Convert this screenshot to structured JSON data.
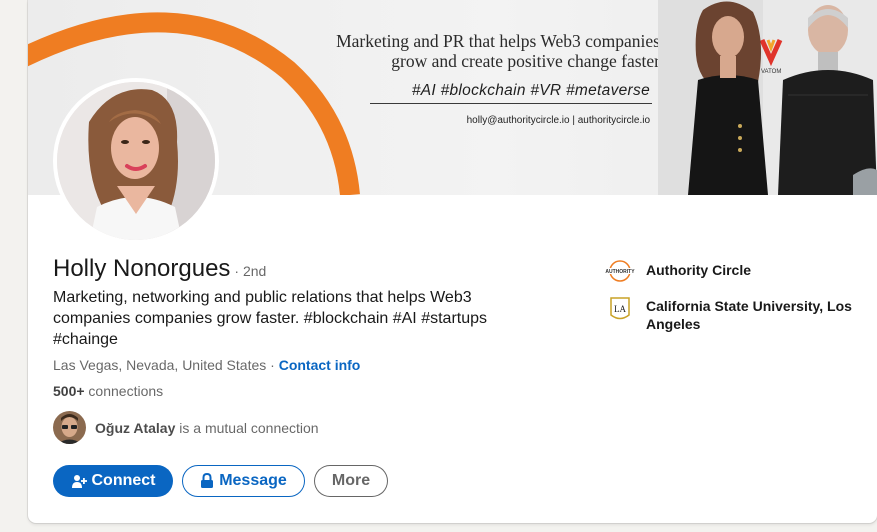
{
  "banner": {
    "headline_line1": "Marketing and PR that helps Web3 companies",
    "headline_line2": "grow and create positive change faster",
    "tags": "#AI #blockchain #VR #metaverse",
    "contact": "holly@authoritycircle.io | authoritycircle.io",
    "vatom_label": "VATOM",
    "accent_color": "#ef7d22"
  },
  "profile": {
    "name": "Holly Nonorgues",
    "degree": "· 2nd",
    "headline": "Marketing, networking and public relations that helps Web3 companies companies grow faster. #blockchain #AI #startups #chainge",
    "location": "Las Vegas, Nevada, United States",
    "location_separator": " · ",
    "contact_info_label": "Contact info",
    "connections_count": "500+",
    "connections_label": " connections"
  },
  "mutual": {
    "name": "Oğuz Atalay",
    "suffix": " is a mutual connection"
  },
  "actions": {
    "connect_label": "Connect",
    "message_label": "Message",
    "more_label": "More"
  },
  "orgs": [
    {
      "name": "Authority Circle",
      "logo_text": "AUTHORITY",
      "icon": "authority-circle-logo"
    },
    {
      "name": "California State University, Los Angeles",
      "logo_text": "LA",
      "icon": "cal-state-la-logo"
    }
  ],
  "colors": {
    "linkedin_blue": "#0a66c2",
    "accent_orange": "#ef7d22"
  }
}
